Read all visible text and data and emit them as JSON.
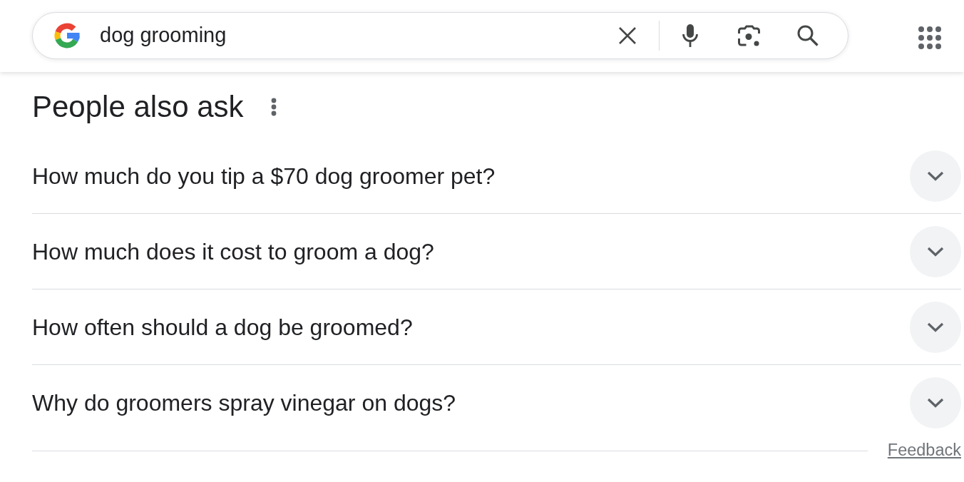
{
  "search": {
    "value": "dog grooming"
  },
  "section": {
    "title": "People also ask"
  },
  "questions": [
    {
      "text": "How much do you tip a $70 dog groomer pet?",
      "expanded": false
    },
    {
      "text": "How much does it cost to groom a dog?",
      "expanded": false
    },
    {
      "text": "How often should a dog be groomed?",
      "expanded": false
    },
    {
      "text": "Why do groomers spray vinegar on dogs?",
      "expanded": false
    }
  ],
  "feedback": "Feedback"
}
